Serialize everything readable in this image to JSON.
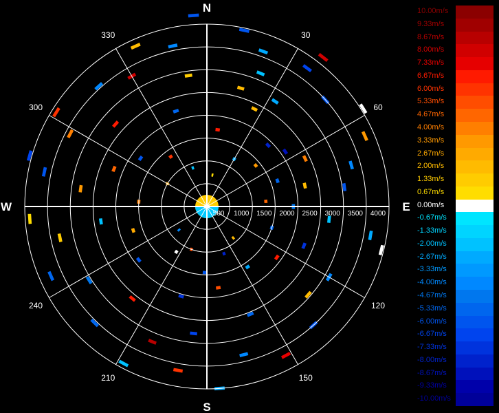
{
  "chart_data": {
    "type": "polar-ppi-radial-velocity",
    "cardinals": [
      "N",
      "E",
      "S",
      "W"
    ],
    "azimuth_labels": [
      "30",
      "60",
      "120",
      "150",
      "210",
      "240",
      "300",
      "330"
    ],
    "range_labels": [
      "500",
      "1000",
      "1500",
      "2000",
      "2500",
      "3000",
      "3500",
      "4000"
    ],
    "range_rings": [
      500,
      1000,
      1500,
      2000,
      2500,
      3000,
      3500,
      4000
    ],
    "azimuth_spokes_deg": [
      0,
      30,
      60,
      90,
      120,
      150,
      180,
      210,
      240,
      270,
      300,
      330
    ],
    "range_max": 4000,
    "legend": [
      {
        "label": "10.00m/s",
        "color": "#8b0000"
      },
      {
        "label": "9.33m/s",
        "color": "#a00000"
      },
      {
        "label": "8.67m/s",
        "color": "#b80000"
      },
      {
        "label": "8.00m/s",
        "color": "#d00000"
      },
      {
        "label": "7.33m/s",
        "color": "#e60000"
      },
      {
        "label": "6.67m/s",
        "color": "#ff1a00"
      },
      {
        "label": "6.00m/s",
        "color": "#ff3300"
      },
      {
        "label": "5.33m/s",
        "color": "#ff4d00"
      },
      {
        "label": "4.67m/s",
        "color": "#ff6600"
      },
      {
        "label": "4.00m/s",
        "color": "#ff7f00"
      },
      {
        "label": "3.33m/s",
        "color": "#ff9900"
      },
      {
        "label": "2.67m/s",
        "color": "#ffaa00"
      },
      {
        "label": "2.00m/s",
        "color": "#ffbb00"
      },
      {
        "label": "1.33m/s",
        "color": "#ffcc00"
      },
      {
        "label": "0.67m/s",
        "color": "#ffdd00"
      },
      {
        "label": "0.00m/s",
        "color": "#ffffff"
      },
      {
        "label": "-0.67m/s",
        "color": "#00e5ff"
      },
      {
        "label": "-1.33m/s",
        "color": "#00d4ff"
      },
      {
        "label": "-2.00m/s",
        "color": "#00c2ff"
      },
      {
        "label": "-2.67m/s",
        "color": "#00aaff"
      },
      {
        "label": "-3.33m/s",
        "color": "#0099ff"
      },
      {
        "label": "-4.00m/s",
        "color": "#0088ff"
      },
      {
        "label": "-4.67m/s",
        "color": "#0077ee"
      },
      {
        "label": "-5.33m/s",
        "color": "#0066ee"
      },
      {
        "label": "-6.00m/s",
        "color": "#0055ee"
      },
      {
        "label": "-6.67m/s",
        "color": "#0044ee"
      },
      {
        "label": "-7.33m/s",
        "color": "#0033dd"
      },
      {
        "label": "-8.00m/s",
        "color": "#0022cc"
      },
      {
        "label": "-8.67m/s",
        "color": "#0011bb"
      },
      {
        "label": "-9.33m/s",
        "color": "#0000aa"
      },
      {
        "label": "-10.00m/s",
        "color": "#000099"
      }
    ],
    "gates": [
      {
        "az": 12,
        "r": 3950,
        "v": -6.0
      },
      {
        "az": 20,
        "r": 3620,
        "v": -2.7
      },
      {
        "az": 22,
        "r": 3150,
        "v": -2.0
      },
      {
        "az": 26,
        "r": 2380,
        "v": 2.0
      },
      {
        "az": 33,
        "r": 2750,
        "v": -2.7
      },
      {
        "az": 36,
        "r": 3750,
        "v": -6.7
      },
      {
        "az": 38,
        "r": 4150,
        "v": 8.0
      },
      {
        "az": 45,
        "r": 1900,
        "v": -8.0
      },
      {
        "az": 48,
        "r": 3500,
        "v": -6.0
      },
      {
        "az": 55,
        "r": 2100,
        "v": -8.7
      },
      {
        "az": 58,
        "r": 4050,
        "v": 0.0
      },
      {
        "az": 64,
        "r": 2400,
        "v": 4.0
      },
      {
        "az": 66,
        "r": 3800,
        "v": 3.3
      },
      {
        "az": 70,
        "r": 1650,
        "v": -5.3
      },
      {
        "az": 74,
        "r": 3300,
        "v": -4.0
      },
      {
        "az": 78,
        "r": 2200,
        "v": 2.0
      },
      {
        "az": 82,
        "r": 3050,
        "v": -6.0
      },
      {
        "az": 85,
        "r": 1300,
        "v": 4.7
      },
      {
        "az": 96,
        "r": 2700,
        "v": -2.0
      },
      {
        "az": 100,
        "r": 3650,
        "v": -2.7
      },
      {
        "az": 104,
        "r": 3950,
        "v": 0.0
      },
      {
        "az": 108,
        "r": 1500,
        "v": -5.3
      },
      {
        "az": 112,
        "r": 2300,
        "v": -7.3
      },
      {
        "az": 120,
        "r": 3100,
        "v": -4.0
      },
      {
        "az": 126,
        "r": 1900,
        "v": 6.7
      },
      {
        "az": 131,
        "r": 2950,
        "v": 2.0
      },
      {
        "az": 138,
        "r": 3500,
        "v": -6.0
      },
      {
        "az": 146,
        "r": 1600,
        "v": -2.7
      },
      {
        "az": 152,
        "r": 3700,
        "v": 7.3
      },
      {
        "az": 158,
        "r": 2550,
        "v": -5.3
      },
      {
        "az": 166,
        "r": 3350,
        "v": -4.0
      },
      {
        "az": 172,
        "r": 1800,
        "v": 5.3
      },
      {
        "az": 176,
        "r": 4000,
        "v": -2.7
      },
      {
        "az": 182,
        "r": 1450,
        "v": -6.0
      },
      {
        "az": 186,
        "r": 2800,
        "v": -6.7
      },
      {
        "az": 190,
        "r": 3650,
        "v": 6.0
      },
      {
        "az": 196,
        "r": 2050,
        "v": -7.3
      },
      {
        "az": 202,
        "r": 3200,
        "v": 8.7
      },
      {
        "az": 208,
        "r": 3900,
        "v": -2.0
      },
      {
        "az": 214,
        "r": 1200,
        "v": 0.0
      },
      {
        "az": 219,
        "r": 2600,
        "v": 6.7
      },
      {
        "az": 224,
        "r": 3550,
        "v": -5.3
      },
      {
        "az": 232,
        "r": 1900,
        "v": -6.0
      },
      {
        "az": 238,
        "r": 3050,
        "v": -4.7
      },
      {
        "az": 246,
        "r": 3750,
        "v": -5.3
      },
      {
        "az": 252,
        "r": 1700,
        "v": 2.7
      },
      {
        "az": 258,
        "r": 3300,
        "v": 1.3
      },
      {
        "az": 262,
        "r": 2350,
        "v": -2.0
      },
      {
        "az": 266,
        "r": 3900,
        "v": 0.7
      },
      {
        "az": 274,
        "r": 1500,
        "v": 4.0
      },
      {
        "az": 278,
        "r": 2800,
        "v": 3.3
      },
      {
        "az": 282,
        "r": 3650,
        "v": -6.0
      },
      {
        "az": 286,
        "r": 4050,
        "v": -6.7
      },
      {
        "az": 292,
        "r": 2200,
        "v": 4.7
      },
      {
        "az": 298,
        "r": 3400,
        "v": 4.0
      },
      {
        "az": 302,
        "r": 3900,
        "v": 6.0
      },
      {
        "az": 306,
        "r": 1800,
        "v": -6.0
      },
      {
        "az": 312,
        "r": 2700,
        "v": 6.7
      },
      {
        "az": 318,
        "r": 3550,
        "v": -4.0
      },
      {
        "az": 324,
        "r": 1350,
        "v": 6.0
      },
      {
        "az": 330,
        "r": 3300,
        "v": 8.0
      },
      {
        "az": 336,
        "r": 3850,
        "v": 2.0
      },
      {
        "az": 342,
        "r": 2200,
        "v": -5.3
      },
      {
        "az": 348,
        "r": 3600,
        "v": -4.0
      },
      {
        "az": 352,
        "r": 2900,
        "v": 1.3
      },
      {
        "az": 356,
        "r": 4200,
        "v": -6.0
      },
      {
        "az": 8,
        "r": 1700,
        "v": 6.7
      },
      {
        "az": 16,
        "r": 2700,
        "v": 2.0
      },
      {
        "az": 30,
        "r": 1200,
        "v": -2.7
      },
      {
        "az": 50,
        "r": 1400,
        "v": 3.3
      },
      {
        "az": 90,
        "r": 1900,
        "v": -4.7
      },
      {
        "az": 140,
        "r": 900,
        "v": 2.0
      },
      {
        "az": 160,
        "r": 1100,
        "v": -8.0
      },
      {
        "az": 200,
        "r": 1000,
        "v": 5.3
      },
      {
        "az": 230,
        "r": 800,
        "v": -4.0
      },
      {
        "az": 300,
        "r": 1000,
        "v": 2.7
      },
      {
        "az": 340,
        "r": 900,
        "v": -2.0
      },
      {
        "az": 10,
        "r": 700,
        "v": 0.7
      }
    ]
  }
}
